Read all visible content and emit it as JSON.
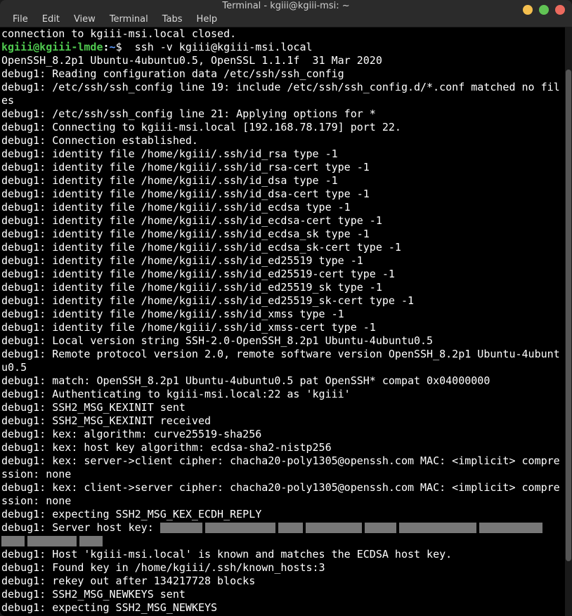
{
  "window": {
    "title": "Terminal - kgiii@kgiii-msi: ~"
  },
  "menu": {
    "file": "File",
    "edit": "Edit",
    "view": "View",
    "terminal": "Terminal",
    "tabs": "Tabs",
    "help": "Help"
  },
  "prompt": {
    "user_host": "kgiii@kgiii-lmde",
    "colon": ":",
    "path": "~",
    "sigil": "$",
    "command": "  ssh -v kgiii@kgiii-msi.local"
  },
  "lines": {
    "l0": "connection to kgiii-msi.local closed.",
    "l1": "OpenSSH_8.2p1 Ubuntu-4ubuntu0.5, OpenSSL 1.1.1f  31 Mar 2020",
    "l2": "debug1: Reading configuration data /etc/ssh/ssh_config",
    "l3": "debug1: /etc/ssh/ssh_config line 19: include /etc/ssh/ssh_config.d/*.conf matched no files",
    "l4": "debug1: /etc/ssh/ssh_config line 21: Applying options for *",
    "l5": "debug1: Connecting to kgiii-msi.local [192.168.78.179] port 22.",
    "l6": "debug1: Connection established.",
    "l7": "debug1: identity file /home/kgiii/.ssh/id_rsa type -1",
    "l8": "debug1: identity file /home/kgiii/.ssh/id_rsa-cert type -1",
    "l9": "debug1: identity file /home/kgiii/.ssh/id_dsa type -1",
    "l10": "debug1: identity file /home/kgiii/.ssh/id_dsa-cert type -1",
    "l11": "debug1: identity file /home/kgiii/.ssh/id_ecdsa type -1",
    "l12": "debug1: identity file /home/kgiii/.ssh/id_ecdsa-cert type -1",
    "l13": "debug1: identity file /home/kgiii/.ssh/id_ecdsa_sk type -1",
    "l14": "debug1: identity file /home/kgiii/.ssh/id_ecdsa_sk-cert type -1",
    "l15": "debug1: identity file /home/kgiii/.ssh/id_ed25519 type -1",
    "l16": "debug1: identity file /home/kgiii/.ssh/id_ed25519-cert type -1",
    "l17": "debug1: identity file /home/kgiii/.ssh/id_ed25519_sk type -1",
    "l18": "debug1: identity file /home/kgiii/.ssh/id_ed25519_sk-cert type -1",
    "l19": "debug1: identity file /home/kgiii/.ssh/id_xmss type -1",
    "l20": "debug1: identity file /home/kgiii/.ssh/id_xmss-cert type -1",
    "l21": "debug1: Local version string SSH-2.0-OpenSSH_8.2p1 Ubuntu-4ubuntu0.5",
    "l22": "debug1: Remote protocol version 2.0, remote software version OpenSSH_8.2p1 Ubuntu-4ubuntu0.5",
    "l23": "debug1: match: OpenSSH_8.2p1 Ubuntu-4ubuntu0.5 pat OpenSSH* compat 0x04000000",
    "l24": "debug1: Authenticating to kgiii-msi.local:22 as 'kgiii'",
    "l25": "debug1: SSH2_MSG_KEXINIT sent",
    "l26": "debug1: SSH2_MSG_KEXINIT received",
    "l27": "debug1: kex: algorithm: curve25519-sha256",
    "l28": "debug1: kex: host key algorithm: ecdsa-sha2-nistp256",
    "l29": "debug1: kex: server->client cipher: chacha20-poly1305@openssh.com MAC: <implicit> compression: none",
    "l30": "debug1: kex: client->server cipher: chacha20-poly1305@openssh.com MAC: <implicit> compression: none",
    "l31": "debug1: expecting SSH2_MSG_KEX_ECDH_REPLY",
    "l32": "debug1: Server host key: ",
    "l33": "debug1: Host 'kgiii-msi.local' is known and matches the ECDSA host key.",
    "l34": "debug1: Found key in /home/kgiii/.ssh/known_hosts:3",
    "l35": "debug1: rekey out after 134217728 blocks",
    "l36": "debug1: SSH2_MSG_NEWKEYS sent",
    "l37": "debug1: expecting SSH2_MSG_NEWKEYS"
  },
  "redacted_widths": [
    60,
    100,
    35,
    80,
    45,
    110,
    90
  ],
  "redacted_line2_widths": [
    33,
    70,
    33
  ]
}
